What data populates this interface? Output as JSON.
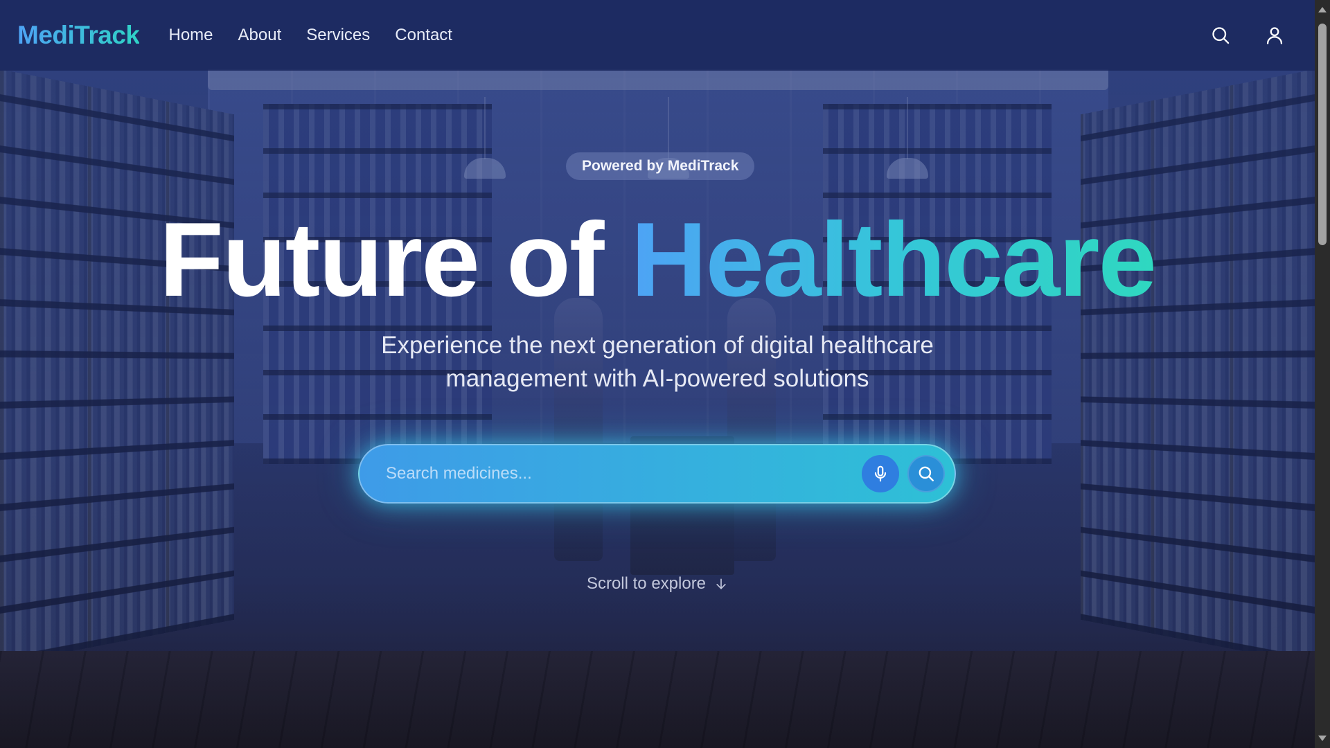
{
  "nav": {
    "logo": "MediTrack",
    "links": [
      "Home",
      "About",
      "Services",
      "Contact"
    ],
    "search_icon": "search-icon",
    "user_icon": "user-icon"
  },
  "hero": {
    "badge": "Powered by MediTrack",
    "headline_plain": "Future of ",
    "headline_accent": "Healthcare",
    "subtitle_line1": "Experience the next generation of digital healthcare",
    "subtitle_line2": "management with AI-powered solutions",
    "search_placeholder": "Search medicines...",
    "mic_icon": "microphone-icon",
    "go_icon": "search-icon",
    "scroll_hint": "Scroll to explore",
    "scroll_icon": "arrow-down-icon"
  },
  "colors": {
    "accent_blue": "#4ea3f5",
    "accent_teal": "#2fd3c6",
    "nav_bg": "#1c2a60"
  }
}
